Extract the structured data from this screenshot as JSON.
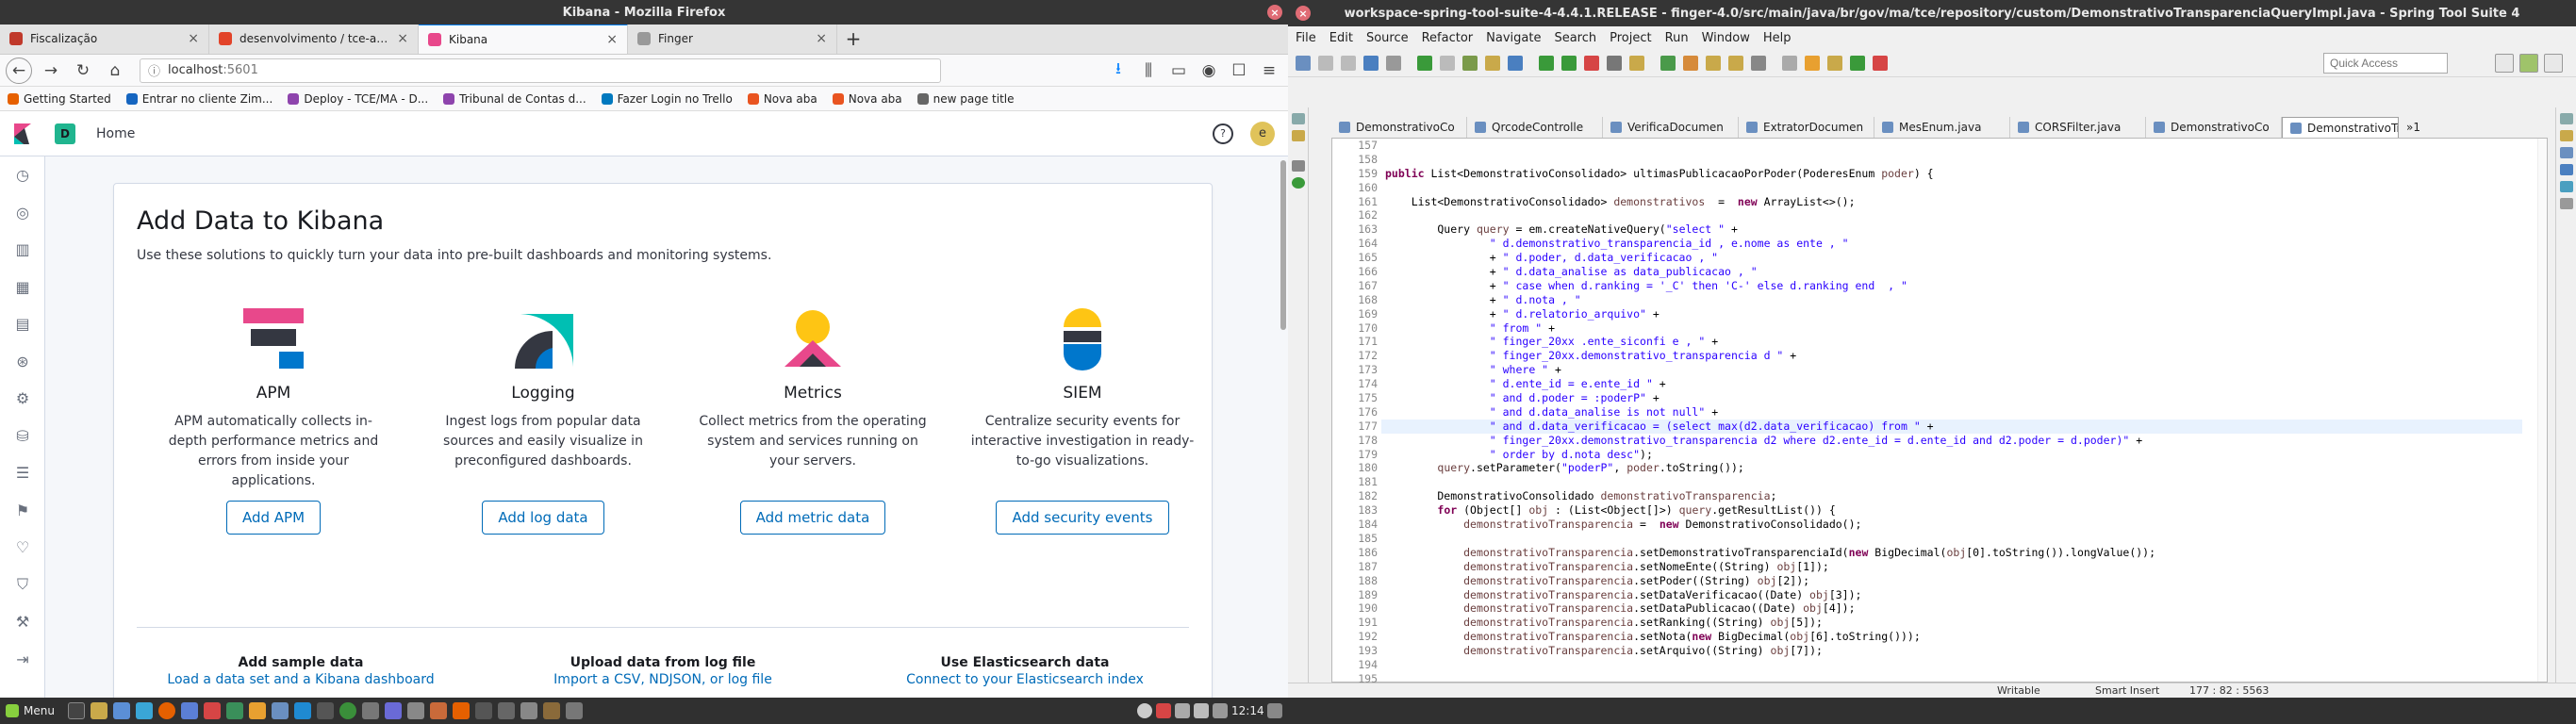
{
  "firefox": {
    "window_title": "Kibana - Mozilla Firefox",
    "tabs": [
      {
        "label": "Fiscalização",
        "color": "#c0392b",
        "active": false
      },
      {
        "label": "desenvolvimento / tce-api · G",
        "color": "#e24329",
        "active": false
      },
      {
        "label": "Kibana",
        "color": "#e8488b",
        "active": true
      },
      {
        "label": "Finger",
        "color": "#999999",
        "active": false
      }
    ],
    "url": "localhost",
    "url_port": ":5601",
    "bookmarks": [
      {
        "label": "Getting Started",
        "color": "#e66000"
      },
      {
        "label": "Entrar no cliente Zim...",
        "color": "#1565c0"
      },
      {
        "label": "Deploy - TCE/MA - D...",
        "color": "#8e44ad"
      },
      {
        "label": "Tribunal de Contas d...",
        "color": "#8e44ad"
      },
      {
        "label": "Fazer Login no Trello",
        "color": "#0079bf"
      },
      {
        "label": "Nova aba",
        "color": "#e95420"
      },
      {
        "label": "Nova aba",
        "color": "#e95420"
      },
      {
        "label": "new page title",
        "color": "#666666"
      }
    ]
  },
  "kibana": {
    "space_letter": "D",
    "breadcrumb": "Home",
    "avatar_letter": "e",
    "panel_title": "Add Data to Kibana",
    "panel_subtitle": "Use these solutions to quickly turn your data into pre-built dashboards and monitoring systems.",
    "solutions": [
      {
        "title": "APM",
        "description": "APM automatically collects in-depth performance metrics and errors from inside your applications.",
        "button": "Add APM",
        "icon": "apm-logo-icon"
      },
      {
        "title": "Logging",
        "description": "Ingest logs from popular data sources and easily visualize in preconfigured dashboards.",
        "button": "Add log data",
        "icon": "logging-logo-icon"
      },
      {
        "title": "Metrics",
        "description": "Collect metrics from the operating system and services running on your servers.",
        "button": "Add metric data",
        "icon": "metrics-logo-icon"
      },
      {
        "title": "SIEM",
        "description": "Centralize security events for interactive investigation in ready-to-go visualizations.",
        "button": "Add security events",
        "icon": "siem-logo-icon"
      }
    ],
    "footer": [
      {
        "title": "Add sample data",
        "link": "Load a data set and a Kibana dashboard"
      },
      {
        "title": "Upload data from log file",
        "link": "Import a CSV, NDJSON, or log file"
      },
      {
        "title": "Use Elasticsearch data",
        "link": "Connect to your Elasticsearch index"
      }
    ]
  },
  "eclipse": {
    "window_title": "workspace-spring-tool-suite-4-4.4.1.RELEASE - finger-4.0/src/main/java/br/gov/ma/tce/repository/custom/DemonstrativoTransparenciaQueryImpl.java - Spring Tool Suite 4",
    "menu": [
      "File",
      "Edit",
      "Source",
      "Refactor",
      "Navigate",
      "Search",
      "Project",
      "Run",
      "Window",
      "Help"
    ],
    "quick_access_placeholder": "Quick Access",
    "tabs": [
      "DemonstrativoCo",
      "QrcodeControlle",
      "VerificaDocumen",
      "ExtratorDocumen",
      "MesEnum.java",
      "CORSFilter.java",
      "DemonstrativoCo",
      "DemonstrativoTr"
    ],
    "tab_overflow": "»1",
    "line_numbers": [
      "157",
      "158",
      "159",
      "160",
      "161",
      "162",
      "163",
      "164",
      "165",
      "166",
      "167",
      "168",
      "169",
      "170",
      "171",
      "172",
      "173",
      "174",
      "175",
      "176",
      "177",
      "178",
      "179",
      "180",
      "181",
      "182",
      "183",
      "184",
      "185",
      "186",
      "187",
      "188",
      "189",
      "190",
      "191",
      "192",
      "193",
      "194",
      "195"
    ],
    "code_lines": [
      "",
      "",
      "<span class=\"kw\">public</span> List&lt;DemonstrativoConsolidado&gt; ultimasPublicacaoPorPoder(PoderesEnum <span class=\"var\">poder</span>) {",
      "",
      "    List&lt;DemonstrativoConsolidado&gt; <span class=\"var\">demonstrativos</span>  =  <span class=\"kw\">new</span> ArrayList&lt;&gt;();",
      "",
      "        Query <span class=\"var\">query</span> = em.createNativeQuery(<span class=\"str\">\"select \"</span> +",
      "                <span class=\"str\">\" d.demonstrativo_transparencia_id , e.nome as ente , \"</span>",
      "                + <span class=\"str\">\" d.poder, d.data_verificacao , \"</span>",
      "                + <span class=\"str\">\" d.data_analise as data_publicacao , \"</span>",
      "                + <span class=\"str\">\" case when d.ranking = '_C' then 'C-' else d.ranking end  , \"</span>",
      "                + <span class=\"str\">\" d.nota , \"</span>",
      "                + <span class=\"str\">\" d.relatorio_arquivo\"</span> +",
      "                <span class=\"str\">\" from \"</span> +",
      "                <span class=\"str\">\" finger_20xx .ente_siconfi e , \"</span> +",
      "                <span class=\"str\">\" finger_20xx.demonstrativo_transparencia d \"</span> +",
      "                <span class=\"str\">\" where \"</span> +",
      "                <span class=\"str\">\" d.ente_id = e.ente_id \"</span> +",
      "                <span class=\"str\">\" and d.poder = :poderP\"</span> +",
      "                <span class=\"str\">\" and d.data_analise is not null\"</span> +",
      "                <span class=\"str\">\" and d.data_verificacao = (select max(d2.data_verificacao) from \"</span> +",
      "                <span class=\"str\">\" finger_20xx.demonstrativo_transparencia d2 where d2.ente_id = d.ente_id and d2.poder = d.poder)\"</span> +",
      "                <span class=\"str\">\" order by d.nota desc\"</span>);",
      "        <span class=\"var\">query</span>.setParameter(<span class=\"str\">\"poderP\"</span>, <span class=\"var\">poder</span>.toString());",
      "",
      "        DemonstrativoConsolidado <span class=\"var\">demonstrativoTransparencia</span>;",
      "        <span class=\"kw\">for</span> (Object[] <span class=\"var\">obj</span> : (List&lt;Object[]&gt;) <span class=\"var\">query</span>.getResultList()) {",
      "            <span class=\"var\">demonstrativoTransparencia</span> =  <span class=\"kw\">new</span> DemonstrativoConsolidado();",
      "",
      "            <span class=\"var\">demonstrativoTransparencia</span>.setDemonstrativoTransparenciaId(<span class=\"kw\">new</span> BigDecimal(<span class=\"var\">obj</span>[0].toString()).longValue());",
      "            <span class=\"var\">demonstrativoTransparencia</span>.setNomeEnte((String) <span class=\"var\">obj</span>[1]);",
      "            <span class=\"var\">demonstrativoTransparencia</span>.setPoder((String) <span class=\"var\">obj</span>[2]);",
      "            <span class=\"var\">demonstrativoTransparencia</span>.setDataVerificacao((Date) <span class=\"var\">obj</span>[3]);",
      "            <span class=\"var\">demonstrativoTransparencia</span>.setDataPublicacao((Date) <span class=\"var\">obj</span>[4]);",
      "            <span class=\"var\">demonstrativoTransparencia</span>.setRanking((String) <span class=\"var\">obj</span>[5]);",
      "            <span class=\"var\">demonstrativoTransparencia</span>.setNota(<span class=\"kw\">new</span> BigDecimal(<span class=\"var\">obj</span>[6].toString()));",
      "            <span class=\"var\">demonstrativoTransparencia</span>.setArquivo((String) <span class=\"var\">obj</span>[7]);",
      "",
      ""
    ],
    "highlighted_line": 177,
    "status": {
      "mode": "Writable",
      "insert": "Smart Insert",
      "position": "177 : 82 : 5563"
    }
  },
  "taskbar": {
    "menu_label": "Menu",
    "clock": "12:14"
  }
}
